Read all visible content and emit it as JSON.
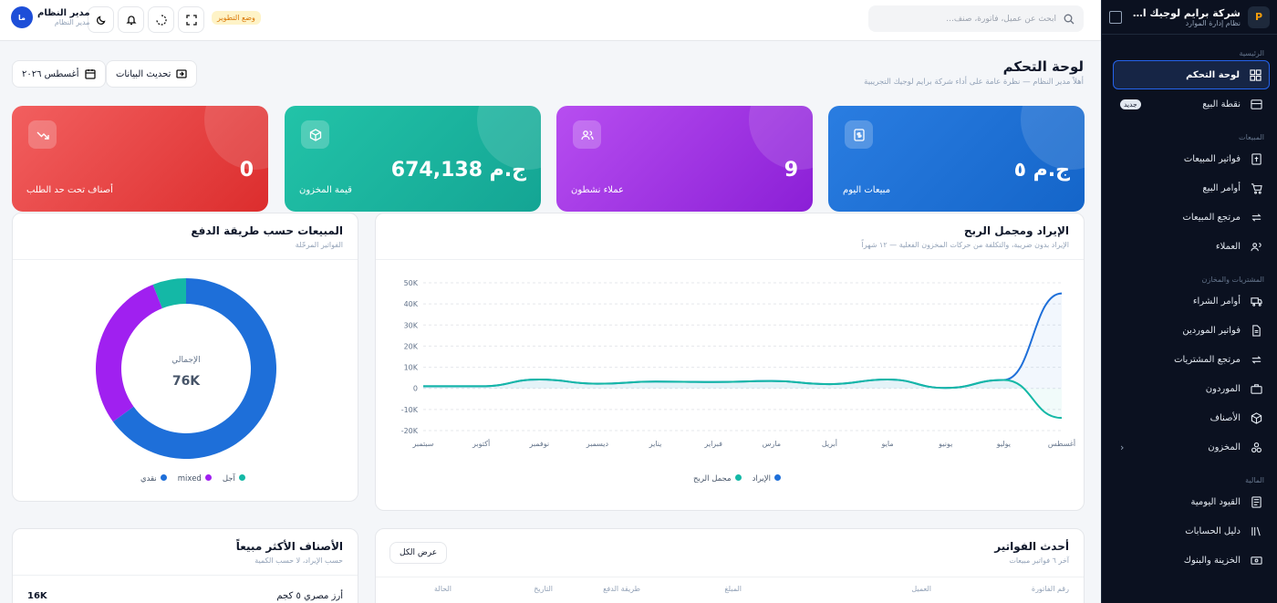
{
  "sidebar": {
    "company": "شركة برايم لوجيك التجر...",
    "subtitle": "نظام إدارة الموارد",
    "logo": "P",
    "sections": [
      {
        "title": "الرئيسية",
        "items": [
          {
            "label": "لوحة التحكم",
            "icon": "dashboard-icon",
            "active": true
          },
          {
            "label": "نقطة البيع",
            "icon": "pos-icon",
            "badge": "جديد"
          }
        ]
      },
      {
        "title": "المبيعات",
        "items": [
          {
            "label": "فواتير المبيعات",
            "icon": "invoice-icon"
          },
          {
            "label": "أوامر البيع",
            "icon": "cart-icon"
          },
          {
            "label": "مرتجع المبيعات",
            "icon": "return-icon"
          },
          {
            "label": "العملاء",
            "icon": "users-icon"
          }
        ]
      },
      {
        "title": "المشتريات والمخازن",
        "items": [
          {
            "label": "أوامر الشراء",
            "icon": "truck-icon"
          },
          {
            "label": "فواتير الموردين",
            "icon": "document-icon"
          },
          {
            "label": "مرتجع المشتريات",
            "icon": "return-icon"
          },
          {
            "label": "الموردون",
            "icon": "supplier-icon"
          },
          {
            "label": "الأصناف",
            "icon": "box-icon"
          },
          {
            "label": "المخزون",
            "icon": "stock-icon",
            "chevron": true
          }
        ]
      },
      {
        "title": "المالية",
        "items": [
          {
            "label": "القيود اليومية",
            "icon": "journal-icon"
          },
          {
            "label": "دليل الحسابات",
            "icon": "accounts-icon"
          },
          {
            "label": "الخزينة والبنوك",
            "icon": "bank-icon"
          }
        ]
      }
    ]
  },
  "topbar": {
    "search_placeholder": "ابحث عن عميل، فاتورة، صنف...",
    "dev_mode": "وضع التطوير",
    "user_name": "مدير النظام",
    "user_role": "مدير النظام",
    "avatar": "ما"
  },
  "page": {
    "title": "لوحة التحكم",
    "subtitle": "أهلاً مدير النظام — نظرة عامة على أداء شركة برايم لوجيك التجريبية",
    "refresh_label": "تحديث البيانات",
    "date_label": "أغسطس ٢٠٢٦"
  },
  "kpis": [
    {
      "label": "مبيعات اليوم",
      "value": "ج.م ٥",
      "icon": "cash-icon",
      "from": "#2a7de1",
      "to": "#1465c9"
    },
    {
      "label": "عملاء نشطون",
      "value": "9",
      "icon": "users-icon",
      "from": "#b74ef0",
      "to": "#8b1fd6"
    },
    {
      "label": "قيمة المخزون",
      "value": "ج.م 674,138",
      "icon": "package-icon",
      "from": "#22c3a8",
      "to": "#14a594"
    },
    {
      "label": "أصناف تحت حد الطلب",
      "value": "0",
      "icon": "trend-down-icon",
      "from": "#f25f5f",
      "to": "#dc2d2d"
    }
  ],
  "revenue_card": {
    "title": "الإيراد ومجمل الربح",
    "subtitle": "الإيراد بدون ضريبة، والتكلفة من حركات المخزون الفعلية — ١٢ شهراً",
    "legend": [
      {
        "label": "الإيراد",
        "color": "#1e6fd9"
      },
      {
        "label": "مجمل الربح",
        "color": "#14b8a6"
      }
    ]
  },
  "payment_card": {
    "title": "المبيعات حسب طريقة الدفع",
    "subtitle": "الفواتير المرحّلة",
    "center_label": "الإجمالي",
    "center_value": "76K",
    "legend": [
      {
        "label": "نقدي",
        "color": "#1e6fd9"
      },
      {
        "label": "mixed",
        "color": "#a020f0"
      },
      {
        "label": "آجل",
        "color": "#14b8a6"
      }
    ]
  },
  "invoices_card": {
    "title": "أحدث الفواتير",
    "subtitle": "آخر ٦ فواتير مبيعات",
    "view_all": "عرض الكل",
    "columns": [
      "رقم الفاتورة",
      "العميل",
      "المبلغ",
      "طريقة الدفع",
      "التاريخ",
      "الحالة"
    ]
  },
  "top_items_card": {
    "title": "الأصناف الأكثر مبيعاً",
    "subtitle": "حسب الإيراد، لا حسب الكمية",
    "rows": [
      {
        "name": "أرز مصري ٥ كجم",
        "value": "16K"
      }
    ]
  },
  "chart_data": [
    {
      "type": "line",
      "categories": [
        "سبتمبر",
        "أكتوبر",
        "نوفمبر",
        "ديسمبر",
        "يناير",
        "فبراير",
        "مارس",
        "أبريل",
        "مايو",
        "يونيو",
        "يوليو",
        "أغسطس"
      ],
      "series": [
        {
          "name": "الإيراد",
          "color": "#1e6fd9",
          "values": [
            1000,
            1000,
            4200,
            2200,
            3200,
            3000,
            3500,
            2000,
            4200,
            200,
            4000,
            45000
          ]
        },
        {
          "name": "مجمل الربح",
          "color": "#14b8a6",
          "values": [
            1000,
            1000,
            4200,
            2200,
            3200,
            3000,
            3500,
            2000,
            4200,
            200,
            4000,
            -14000
          ]
        }
      ],
      "ylim": [
        -20000,
        50000
      ],
      "yticks": [
        "50K",
        "40K",
        "30K",
        "20K",
        "10K",
        "0",
        "-10K",
        "-20K"
      ],
      "grid": true
    },
    {
      "type": "pie",
      "categories": [
        "نقدي",
        "mixed",
        "آجل"
      ],
      "values": [
        0.65,
        0.29,
        0.06
      ],
      "colors": [
        "#1e6fd9",
        "#a020f0",
        "#14b8a6"
      ]
    }
  ]
}
